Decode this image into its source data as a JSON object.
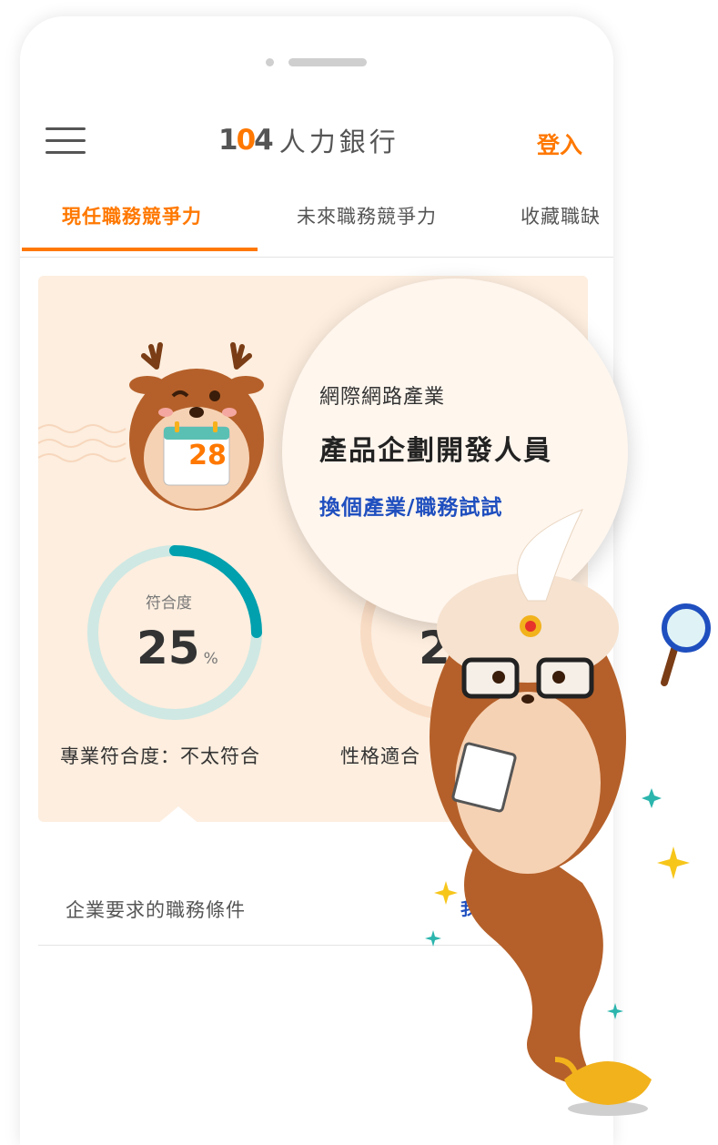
{
  "header": {
    "brand_number": "104",
    "brand_text": "人力銀行",
    "login_label": "登入"
  },
  "tabs": [
    {
      "label": "現任職務競爭力",
      "active": true
    },
    {
      "label": "未來職務競爭力",
      "active": false
    },
    {
      "label": "收藏職缺",
      "active": false
    }
  ],
  "calendar": {
    "day": "28"
  },
  "bubble": {
    "industry": "網際網路產業",
    "job_title": "產品企劃開發人員",
    "change_link": "換個產業/職務試試"
  },
  "match": {
    "professional": {
      "label": "符合度",
      "value": "25",
      "unit": "%",
      "fraction": 0.25,
      "caption": "專業符合度：不太符合"
    },
    "personality": {
      "value": "2",
      "caption": "性格適合"
    }
  },
  "requirements": {
    "title": "企業要求的職務條件",
    "link": "我有"
  },
  "colors": {
    "accent": "#ff7800",
    "link": "#1f4fbf",
    "card_bg": "#fdeedf",
    "ring_track": "#cfe8e3",
    "ring_fill": "#00a0ae"
  }
}
